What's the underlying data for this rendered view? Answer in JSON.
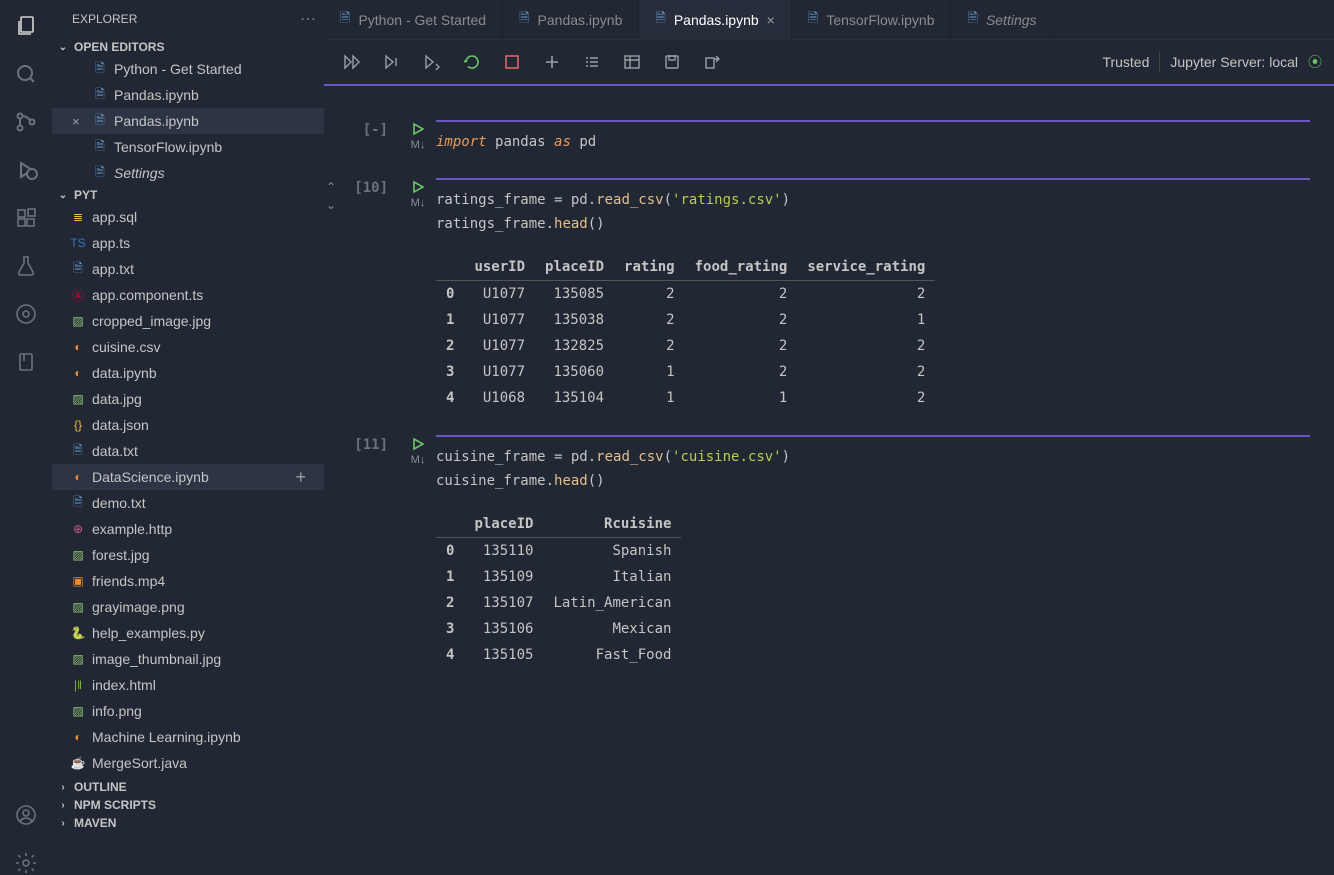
{
  "sidebar_title": "EXPLORER",
  "open_editors_label": "OPEN EDITORS",
  "open_editors": [
    {
      "label": "Python - Get Started",
      "icon": "file",
      "close": ""
    },
    {
      "label": "Pandas.ipynb",
      "icon": "file",
      "close": ""
    },
    {
      "label": "Pandas.ipynb",
      "icon": "file",
      "close": "×",
      "selected": true
    },
    {
      "label": "TensorFlow.ipynb",
      "icon": "file",
      "close": ""
    },
    {
      "label": "Settings",
      "icon": "file",
      "close": "",
      "italic": true
    }
  ],
  "project_label": "PYT",
  "files": [
    {
      "label": "app.sql",
      "icon": "db"
    },
    {
      "label": "app.ts",
      "icon": "ts"
    },
    {
      "label": "app.txt",
      "icon": "file"
    },
    {
      "label": "app.component.ts",
      "icon": "ang"
    },
    {
      "label": "cropped_image.jpg",
      "icon": "img"
    },
    {
      "label": "cuisine.csv",
      "icon": "jup"
    },
    {
      "label": "data.ipynb",
      "icon": "jup"
    },
    {
      "label": "data.jpg",
      "icon": "img"
    },
    {
      "label": "data.json",
      "icon": "json"
    },
    {
      "label": "data.txt",
      "icon": "file"
    },
    {
      "label": "DataScience.ipynb",
      "icon": "jup",
      "selected": true
    },
    {
      "label": "demo.txt",
      "icon": "file"
    },
    {
      "label": "example.http",
      "icon": "http"
    },
    {
      "label": "forest.jpg",
      "icon": "img"
    },
    {
      "label": "friends.mp4",
      "icon": "video"
    },
    {
      "label": "grayimage.png",
      "icon": "img"
    },
    {
      "label": "help_examples.py",
      "icon": "py"
    },
    {
      "label": "image_thumbnail.jpg",
      "icon": "img"
    },
    {
      "label": "index.html",
      "icon": "html"
    },
    {
      "label": "info.png",
      "icon": "img"
    },
    {
      "label": "Machine Learning.ipynb",
      "icon": "jup"
    },
    {
      "label": "MergeSort.java",
      "icon": "java"
    }
  ],
  "outline_label": "OUTLINE",
  "npm_label": "NPM SCRIPTS",
  "maven_label": "MAVEN",
  "tabs": [
    {
      "label": "Python - Get Started"
    },
    {
      "label": "Pandas.ipynb"
    },
    {
      "label": "Pandas.ipynb",
      "active": true,
      "close": "×"
    },
    {
      "label": "TensorFlow.ipynb"
    },
    {
      "label": "Settings",
      "italic": true
    }
  ],
  "trusted": "Trusted",
  "server": "Jupyter Server: local",
  "cells": [
    {
      "exec": "[-]",
      "md": "M↓",
      "code": [
        {
          "t": "import ",
          "c": "kw"
        },
        {
          "t": "pandas ",
          "c": ""
        },
        {
          "t": "as ",
          "c": "kw"
        },
        {
          "t": "pd",
          "c": ""
        }
      ]
    },
    {
      "exec": "[10]",
      "md": "M↓",
      "arrows": true,
      "code": [
        {
          "t": "ratings_frame = pd.",
          "c": ""
        },
        {
          "t": "read_csv",
          "c": "fn"
        },
        {
          "t": "(",
          "c": ""
        },
        {
          "t": "'ratings.csv'",
          "c": "str"
        },
        {
          "t": ")\n",
          "c": ""
        },
        {
          "t": "ratings_frame.",
          "c": ""
        },
        {
          "t": "head",
          "c": "fn"
        },
        {
          "t": "()",
          "c": ""
        }
      ],
      "table": {
        "headers": [
          "",
          "userID",
          "placeID",
          "rating",
          "food_rating",
          "service_rating"
        ],
        "rows": [
          [
            "0",
            "U1077",
            "135085",
            "2",
            "2",
            "2"
          ],
          [
            "1",
            "U1077",
            "135038",
            "2",
            "2",
            "1"
          ],
          [
            "2",
            "U1077",
            "132825",
            "2",
            "2",
            "2"
          ],
          [
            "3",
            "U1077",
            "135060",
            "1",
            "2",
            "2"
          ],
          [
            "4",
            "U1068",
            "135104",
            "1",
            "1",
            "2"
          ]
        ]
      }
    },
    {
      "exec": "[11]",
      "md": "M↓",
      "code": [
        {
          "t": "cuisine_frame = pd.",
          "c": ""
        },
        {
          "t": "read_csv",
          "c": "fn"
        },
        {
          "t": "(",
          "c": ""
        },
        {
          "t": "'cuisine.csv'",
          "c": "str"
        },
        {
          "t": ")\n",
          "c": ""
        },
        {
          "t": "cuisine_frame.",
          "c": ""
        },
        {
          "t": "head",
          "c": "fn"
        },
        {
          "t": "()",
          "c": ""
        }
      ],
      "table": {
        "headers": [
          "",
          "placeID",
          "Rcuisine"
        ],
        "rows": [
          [
            "0",
            "135110",
            "Spanish"
          ],
          [
            "1",
            "135109",
            "Italian"
          ],
          [
            "2",
            "135107",
            "Latin_American"
          ],
          [
            "3",
            "135106",
            "Mexican"
          ],
          [
            "4",
            "135105",
            "Fast_Food"
          ]
        ]
      }
    }
  ]
}
